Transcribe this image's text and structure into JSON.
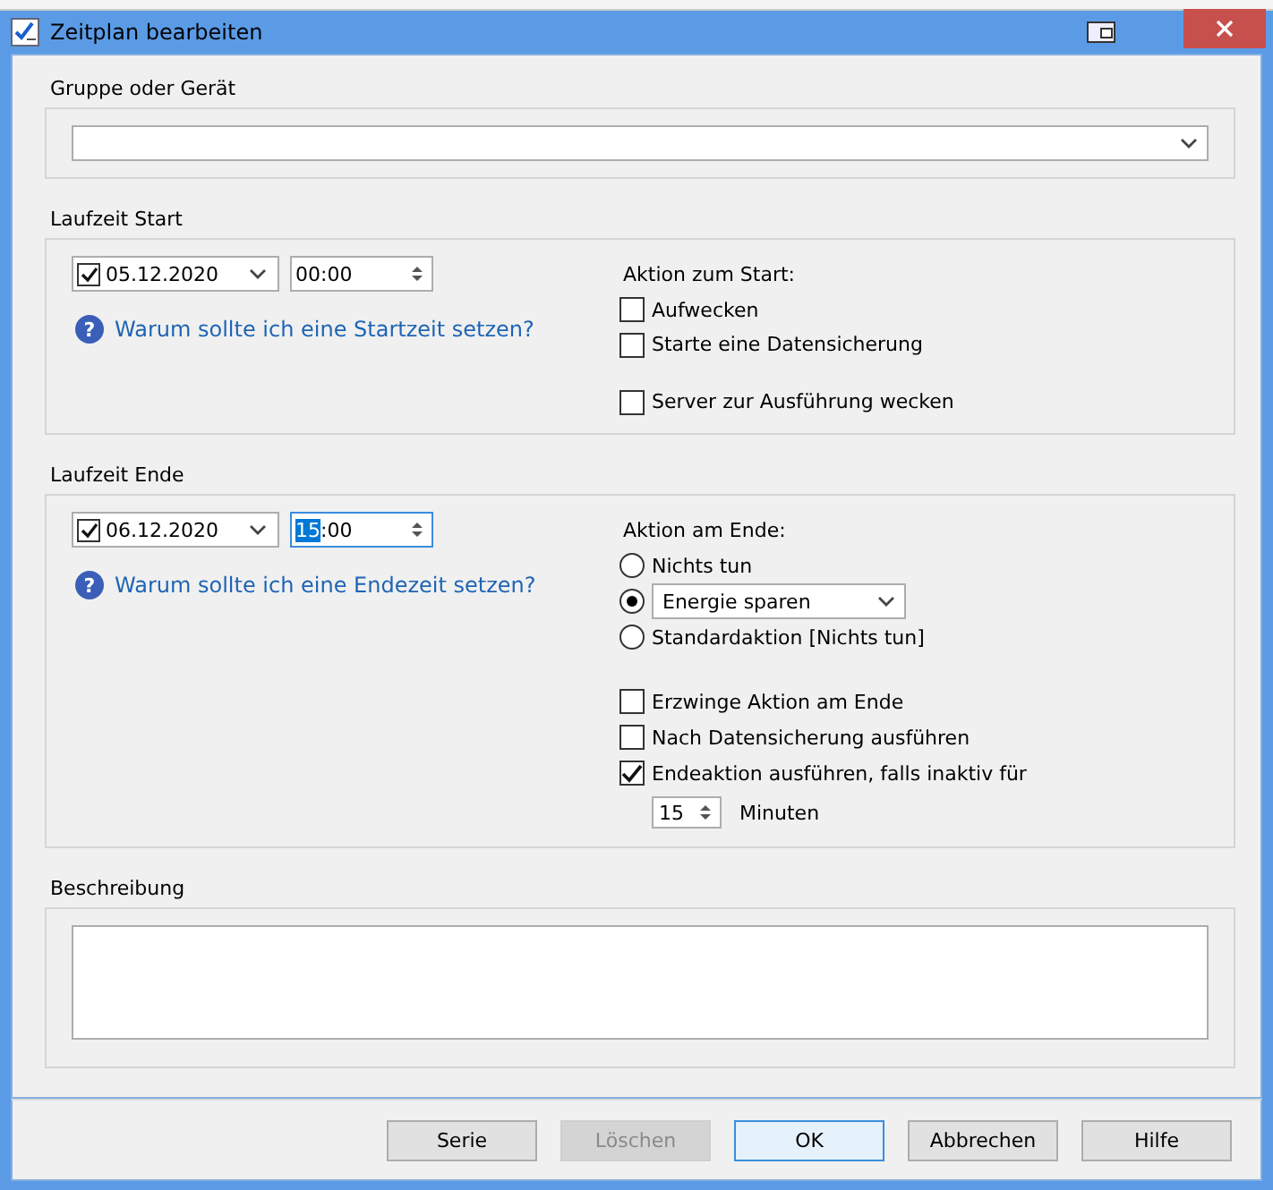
{
  "window": {
    "title": "Zeitplan bearbeiten"
  },
  "group": {
    "label": "Gruppe oder Gerät"
  },
  "start": {
    "label": "Laufzeit Start",
    "date": "05.12.2020",
    "date_checked": true,
    "time_parts": [
      {
        "text": "00:00",
        "selected": false
      }
    ],
    "time_focused": false,
    "help_icon": "?",
    "help_link": "Warum sollte ich eine Startzeit setzen?",
    "action_label": "Aktion zum Start:",
    "options": [
      {
        "label": "Aufwecken",
        "checked": false,
        "gap": false
      },
      {
        "label": "Starte eine Datensicherung",
        "checked": false,
        "gap": false
      },
      {
        "label": "Server zur Ausführung wecken",
        "checked": false,
        "gap": true
      }
    ]
  },
  "end": {
    "label": "Laufzeit Ende",
    "date": "06.12.2020",
    "date_checked": true,
    "time_parts": [
      {
        "text": "15",
        "selected": true
      },
      {
        "text": ":00",
        "selected": false
      }
    ],
    "time_focused": true,
    "help_icon": "?",
    "help_link": "Warum sollte ich eine Endezeit setzen?",
    "action_label": "Aktion am Ende:",
    "radios": [
      {
        "kind": "text",
        "label": "Nichts tun",
        "selected": false
      },
      {
        "kind": "dropdown",
        "value": "Energie sparen",
        "selected": true
      },
      {
        "kind": "text",
        "label": "Standardaktion [Nichts tun]",
        "selected": false
      }
    ],
    "options": [
      {
        "label": "Erzwinge Aktion am Ende",
        "checked": false
      },
      {
        "label": "Nach Datensicherung ausführen",
        "checked": false
      },
      {
        "label": "Endeaktion ausführen, falls inaktiv für",
        "checked": true
      }
    ],
    "minutes_value": "15",
    "minutes_unit": "Minuten"
  },
  "description": {
    "label": "Beschreibung"
  },
  "buttons": [
    {
      "label": "Serie",
      "disabled": false,
      "default": false
    },
    {
      "label": "Löschen",
      "disabled": true,
      "default": false
    },
    {
      "label": "OK",
      "disabled": false,
      "default": true
    },
    {
      "label": "Abbrechen",
      "disabled": false,
      "default": false
    },
    {
      "label": "Hilfe",
      "disabled": false,
      "default": false
    }
  ]
}
